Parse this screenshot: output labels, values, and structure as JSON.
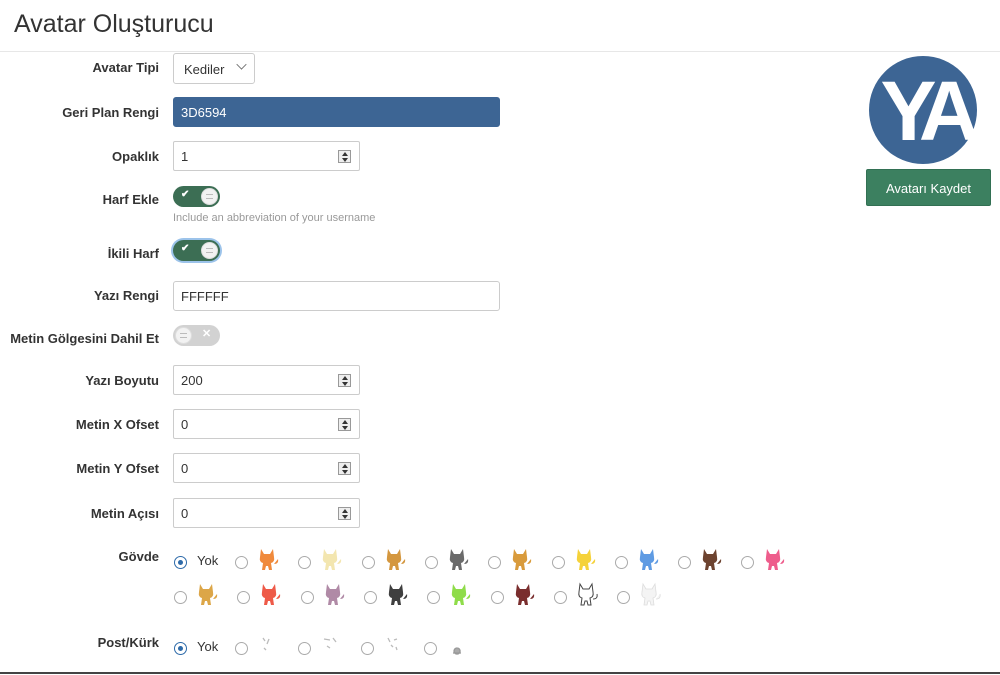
{
  "page": {
    "title": "Avatar Oluşturucu"
  },
  "form": {
    "avatar_type": {
      "label": "Avatar Tipi",
      "value": "Kediler"
    },
    "bg_color": {
      "label": "Geri Plan Rengi",
      "value": "3D6594",
      "color": "#3D6594"
    },
    "opacity": {
      "label": "Opaklık",
      "value": "1"
    },
    "add_letter": {
      "label": "Harf Ekle",
      "on": true,
      "help": "Include an abbreviation of your username"
    },
    "double_letter": {
      "label": "İkili Harf",
      "on": true
    },
    "text_color": {
      "label": "Yazı Rengi",
      "value": "FFFFFF"
    },
    "text_shadow": {
      "label": "Metin Gölgesini Dahil Et",
      "on": false
    },
    "font_size": {
      "label": "Yazı Boyutu",
      "value": "200"
    },
    "offset_x": {
      "label": "Metin X Ofset",
      "value": "0"
    },
    "offset_y": {
      "label": "Metin Y Ofset",
      "value": "0"
    },
    "angle": {
      "label": "Metin Açısı",
      "value": "0"
    },
    "body": {
      "label": "Gövde",
      "none_label": "Yok",
      "options": [
        {
          "icon": "cat-icon",
          "color": "#f08a3c"
        },
        {
          "icon": "cat-icon",
          "color": "#f3e6b0"
        },
        {
          "icon": "cat-icon",
          "color": "#d4973f"
        },
        {
          "icon": "cat-icon",
          "color": "#6b6b6b"
        },
        {
          "icon": "cat-icon",
          "color": "#d99b3c"
        },
        {
          "icon": "cat-icon",
          "color": "#f5d23a"
        },
        {
          "icon": "cat-icon",
          "color": "#5f9be3"
        },
        {
          "icon": "cat-icon",
          "color": "#6d4330"
        },
        {
          "icon": "cat-icon",
          "color": "#ee5d8c"
        },
        {
          "icon": "cat-icon",
          "color": "#dca648"
        },
        {
          "icon": "cat-icon",
          "color": "#ee5a48"
        },
        {
          "icon": "cat-icon",
          "color": "#b08aa6"
        },
        {
          "icon": "cat-icon",
          "color": "#3f3f3f"
        },
        {
          "icon": "cat-icon",
          "color": "#8fdc4a"
        },
        {
          "icon": "cat-icon",
          "color": "#7a2e2e"
        },
        {
          "icon": "cat-outline-icon",
          "color": "#ffffff"
        },
        {
          "icon": "cat-faint-icon",
          "color": "#f4f4f4"
        }
      ]
    },
    "fur": {
      "label": "Post/Kürk",
      "none_label": "Yok",
      "options": [
        {
          "icon": "fur-pattern-1-icon"
        },
        {
          "icon": "fur-pattern-2-icon"
        },
        {
          "icon": "fur-pattern-3-icon"
        },
        {
          "icon": "fur-pattern-4-icon"
        }
      ]
    }
  },
  "preview": {
    "letters": "YA",
    "save_label": "Avatarı Kaydet",
    "bg": "#3D6594",
    "fg": "#FFFFFF",
    "button_color": "#3c8060"
  }
}
